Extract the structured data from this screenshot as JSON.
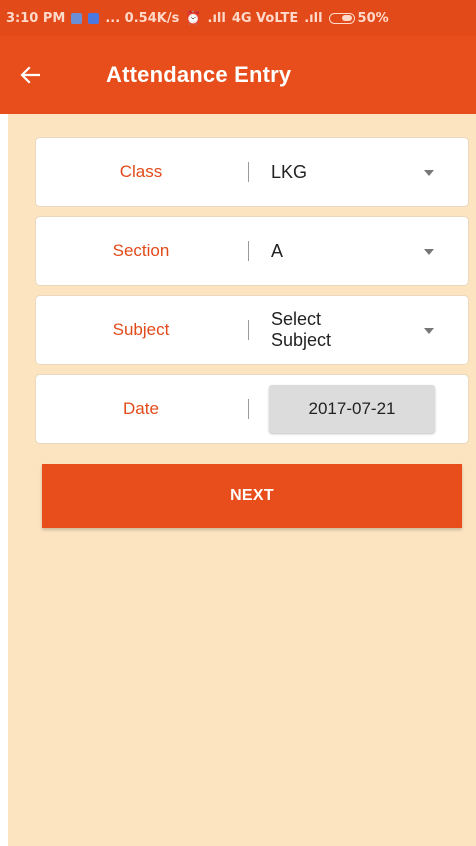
{
  "status_bar": {
    "time": "3:10 PM",
    "net_speed": "... 0.54K/s",
    "network": "4G VoLTE",
    "battery": "50%"
  },
  "app_bar": {
    "title": "Attendance Entry"
  },
  "form": {
    "class": {
      "label": "Class",
      "value": "LKG"
    },
    "section": {
      "label": "Section",
      "value": "A"
    },
    "subject": {
      "label": "Subject",
      "value": "Select Subject"
    },
    "date": {
      "label": "Date",
      "value": "2017-07-21"
    }
  },
  "next_button": {
    "label": "NEXT"
  },
  "colors": {
    "primary": "#e84e1b",
    "background": "#fce4c1",
    "label": "#e24a1a"
  }
}
